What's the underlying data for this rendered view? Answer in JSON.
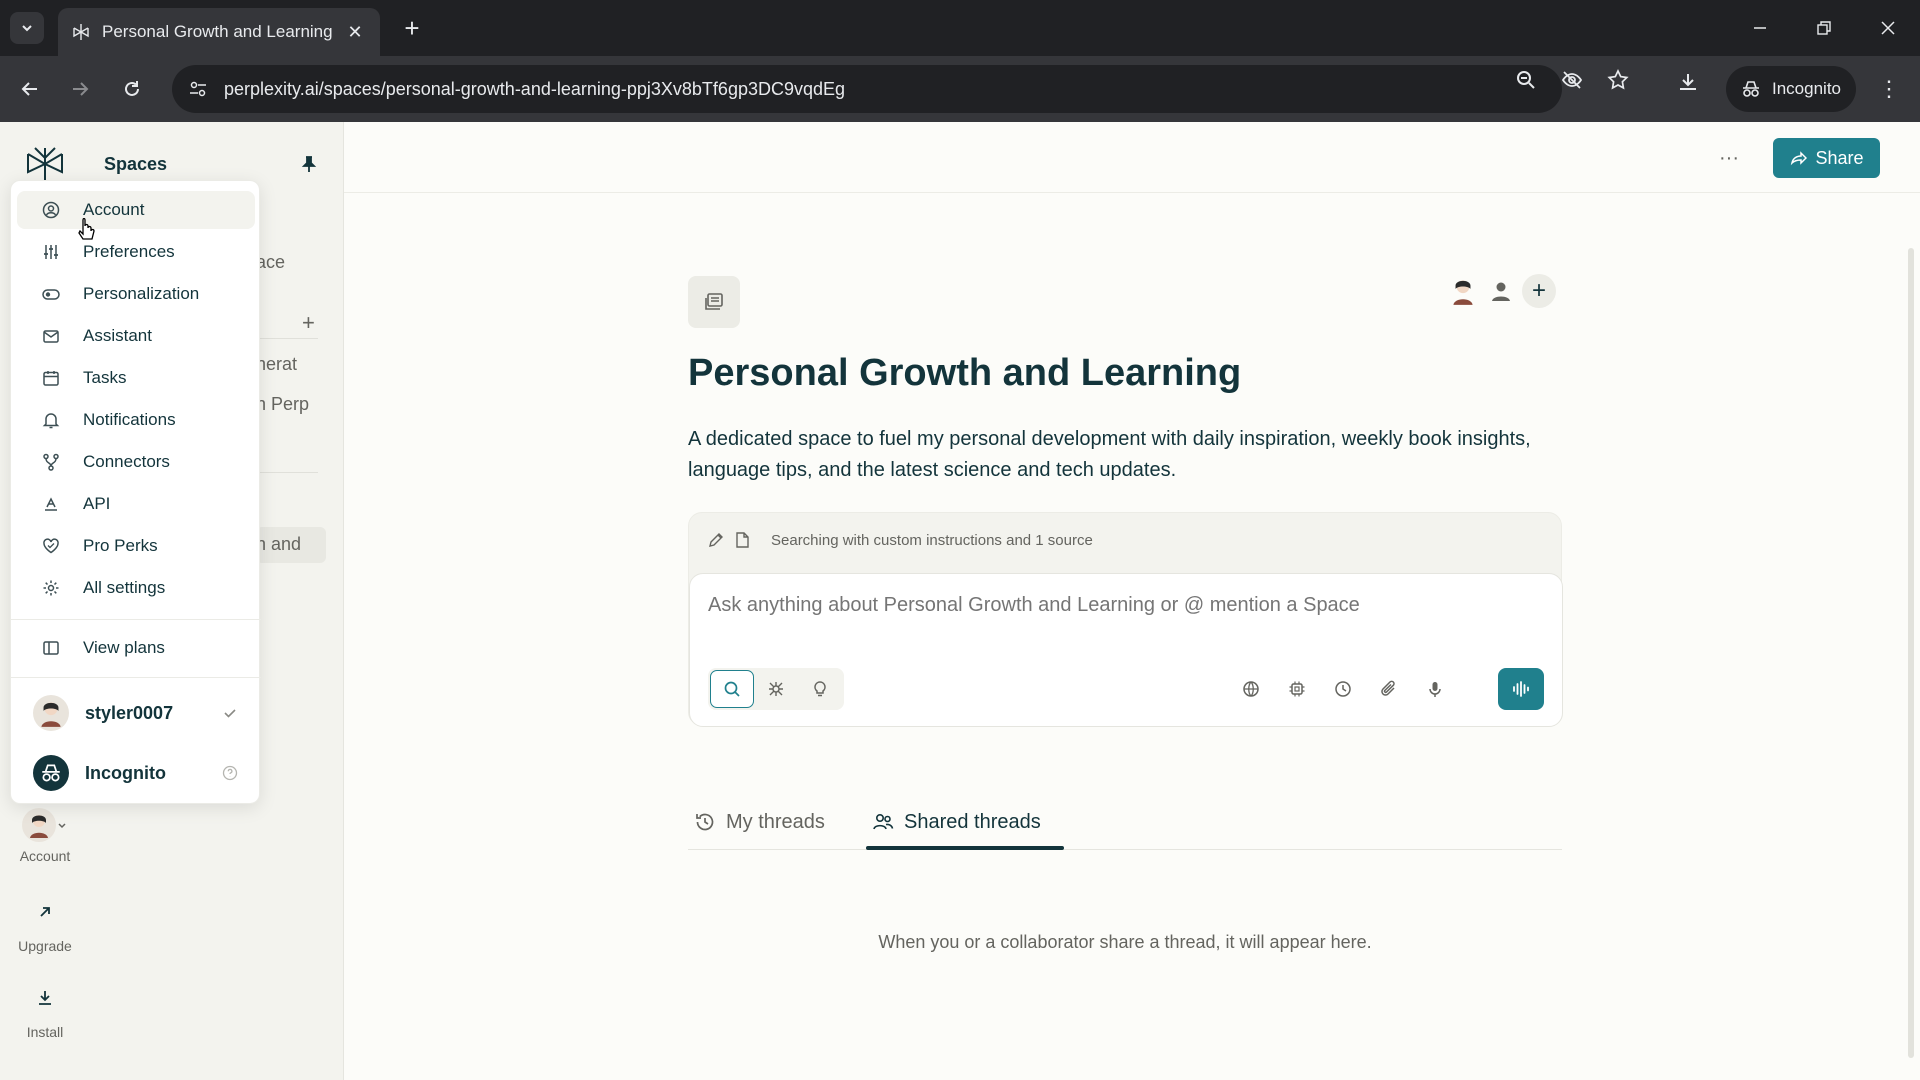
{
  "browser": {
    "tab_title": "Personal Growth and Learning",
    "url": "perplexity.ai/spaces/personal-growth-and-learning-ppj3Xv8bTf6gp3DC9vqdEg",
    "incognito_label": "Incognito"
  },
  "sidebar": {
    "title": "Spaces",
    "background_fragments": [
      "ace",
      "nerat",
      "h Perp",
      "h and"
    ],
    "rail": [
      {
        "label": "Account"
      },
      {
        "label": "Upgrade"
      },
      {
        "label": "Install"
      }
    ]
  },
  "menu": {
    "items": [
      {
        "label": "Account",
        "icon": "account-circle-icon"
      },
      {
        "label": "Preferences",
        "icon": "sliders-icon"
      },
      {
        "label": "Personalization",
        "icon": "toggle-icon"
      },
      {
        "label": "Assistant",
        "icon": "mail-icon"
      },
      {
        "label": "Tasks",
        "icon": "calendar-icon"
      },
      {
        "label": "Notifications",
        "icon": "bell-icon"
      },
      {
        "label": "Connectors",
        "icon": "connector-icon"
      },
      {
        "label": "API",
        "icon": "api-icon"
      },
      {
        "label": "Pro Perks",
        "icon": "heart-icon"
      },
      {
        "label": "All settings",
        "icon": "gear-icon"
      }
    ],
    "view_plans": "View plans",
    "accounts": [
      {
        "name": "styler0007",
        "status": "selected"
      },
      {
        "name": "Incognito",
        "status": "help"
      }
    ]
  },
  "header": {
    "share_label": "Share"
  },
  "space": {
    "title": "Personal Growth and Learning",
    "description": "A dedicated space to fuel my personal development with daily inspiration, weekly book insights, language tips, and the latest science and tech updates.",
    "instructions_note": "Searching with custom instructions and 1 source",
    "input_placeholder": "Ask anything about Personal Growth and Learning or @ mention a Space"
  },
  "threads": {
    "tabs": [
      {
        "label": "My threads"
      },
      {
        "label": "Shared threads"
      }
    ],
    "active_tab": "Shared threads",
    "empty_message": "When you or a collaborator share a thread, it will appear here."
  },
  "colors": {
    "accent": "#20808d",
    "text": "#13343b",
    "muted": "#64645f",
    "background": "#fcfcf9",
    "sidebar": "#f3f3ee"
  }
}
